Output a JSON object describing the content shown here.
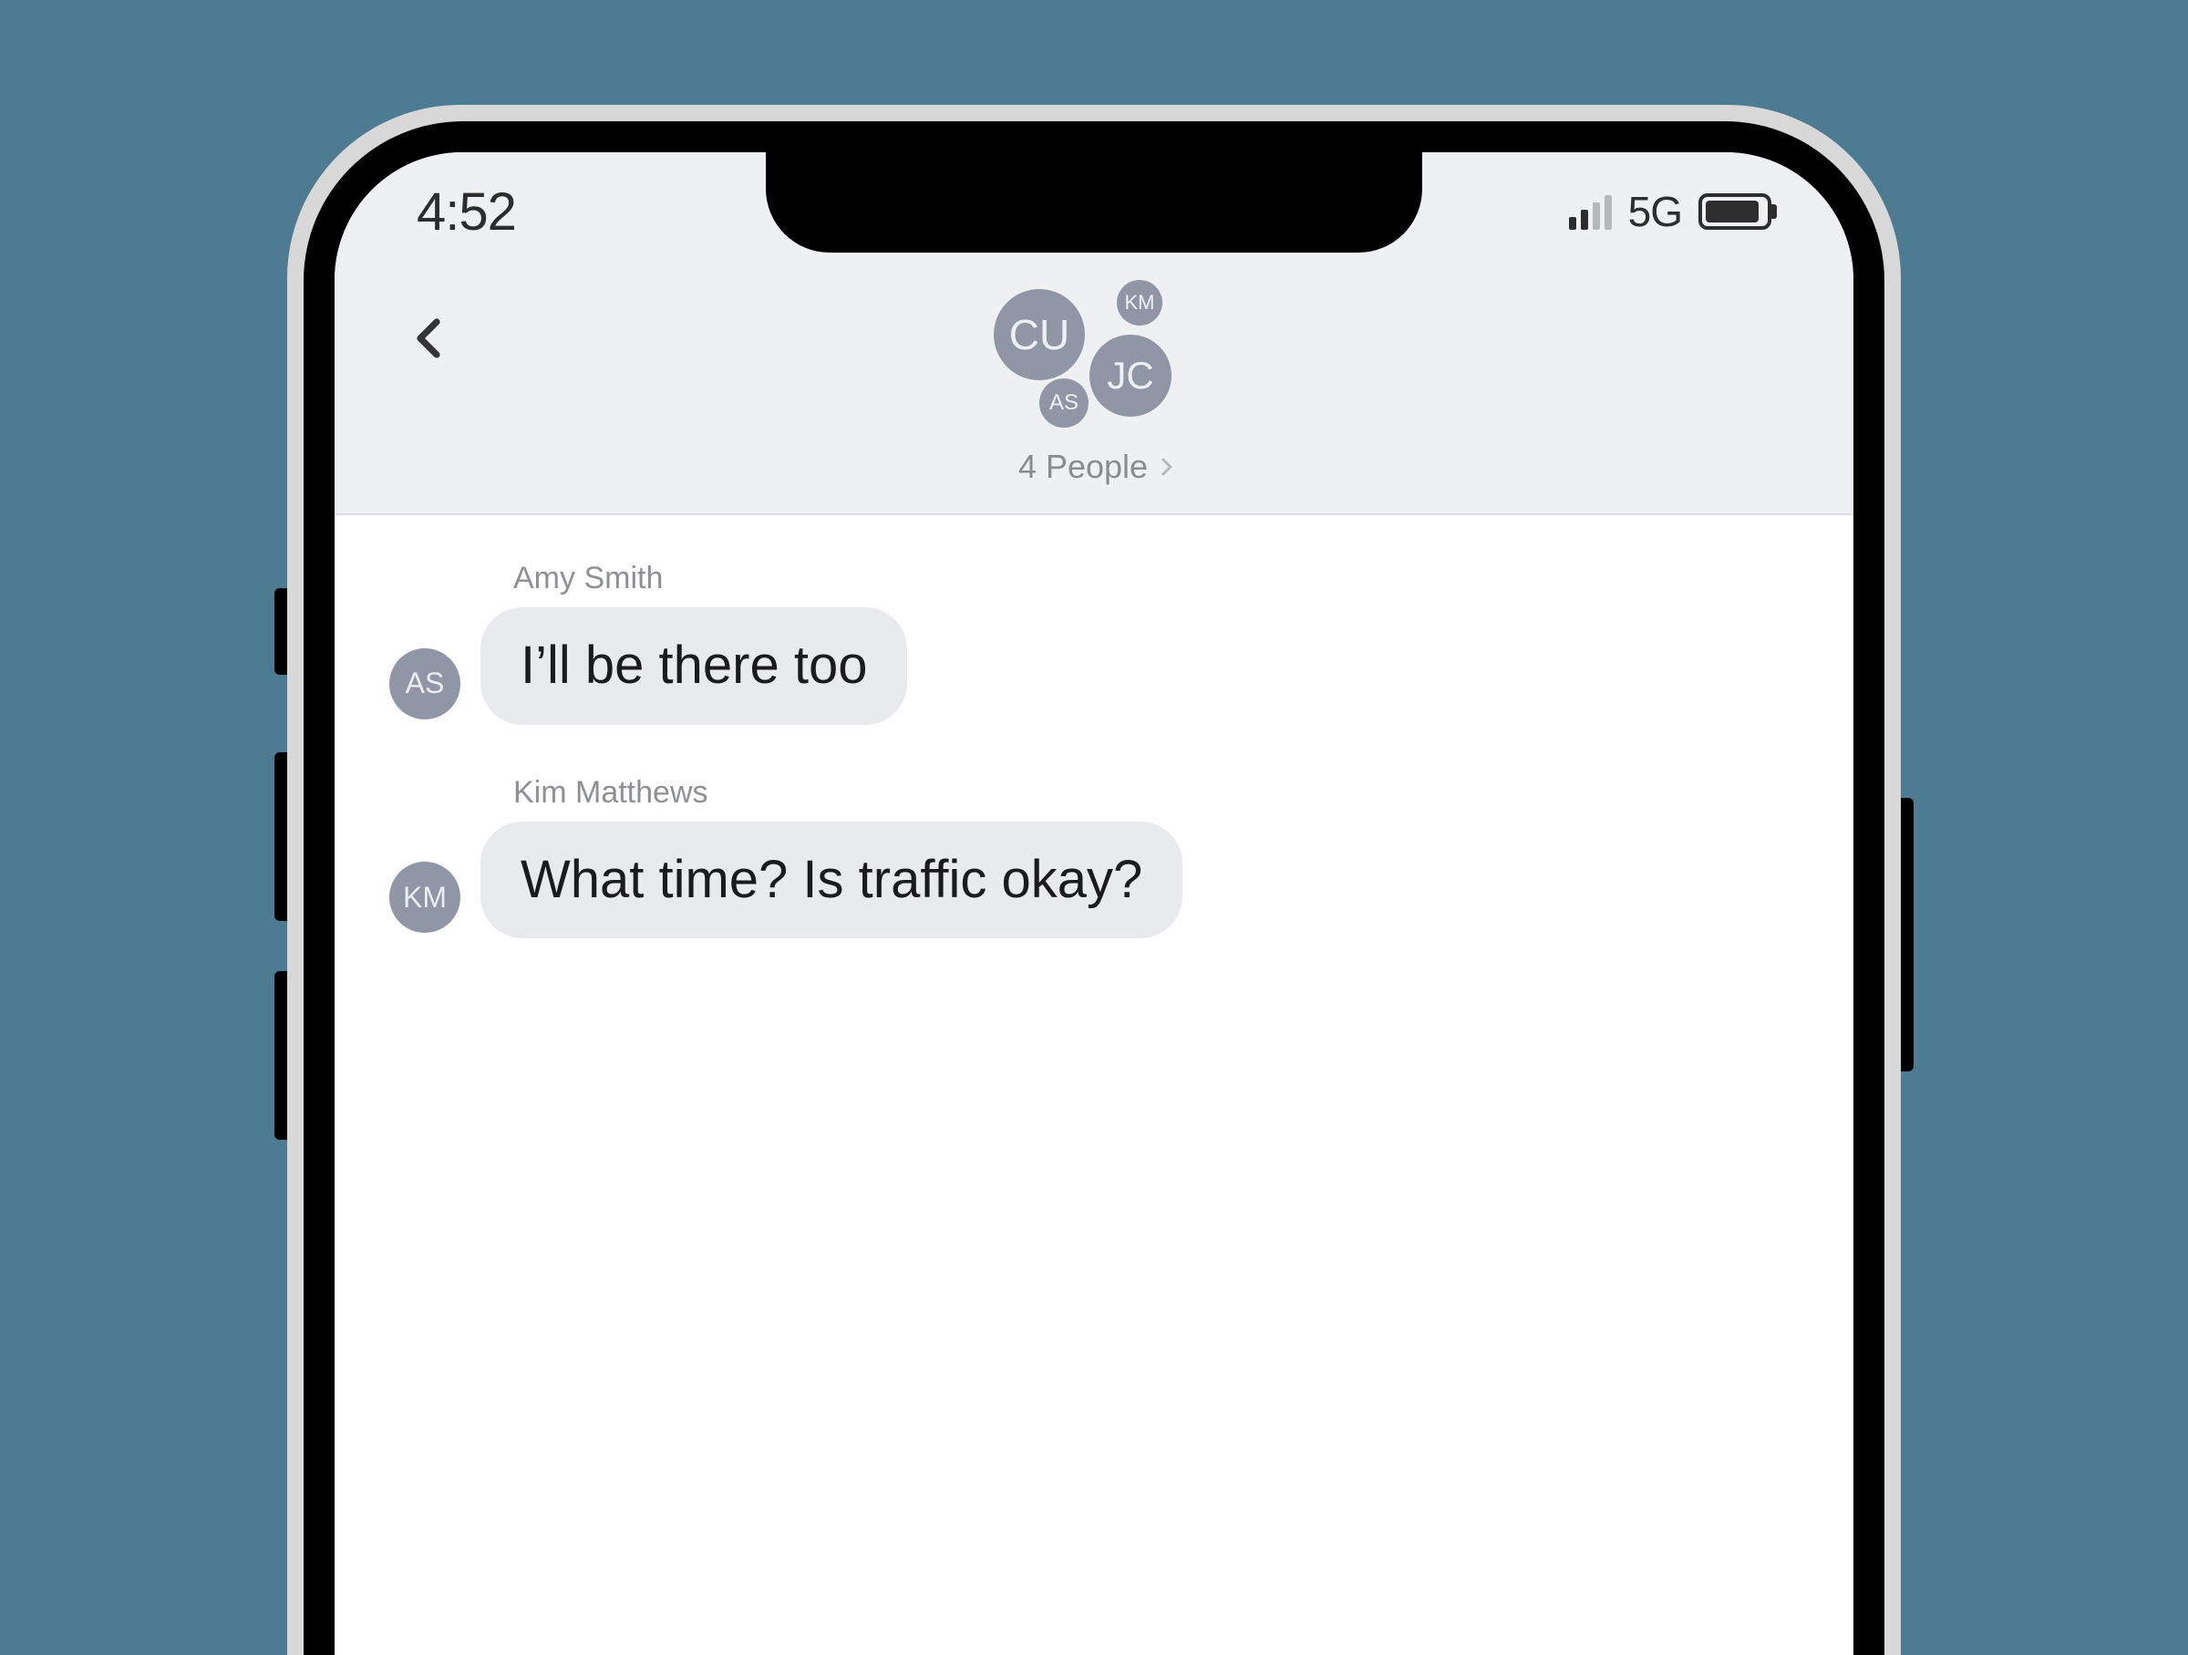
{
  "status_bar": {
    "time": "4:52",
    "network": "5G"
  },
  "header": {
    "group_label": "4 People",
    "avatars": {
      "cu": "CU",
      "jc": "JC",
      "km": "KM",
      "as": "AS"
    }
  },
  "messages": [
    {
      "sender_name": "Amy Smith",
      "sender_initials": "AS",
      "text": "I’ll be there too"
    },
    {
      "sender_name": "Kim Matthews",
      "sender_initials": "KM",
      "text": "What time? Is traffic okay?"
    }
  ]
}
